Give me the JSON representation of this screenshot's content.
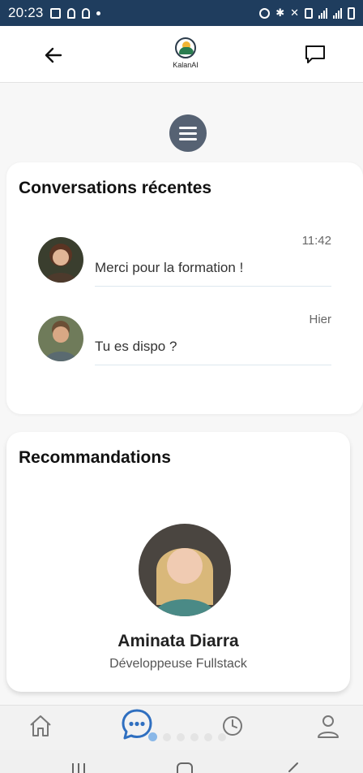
{
  "status_bar": {
    "time": "20:23"
  },
  "app": {
    "logo_text": "KalanAI"
  },
  "recent": {
    "title": "Conversations récentes",
    "items": [
      {
        "message": "Merci pour la formation !",
        "time": "11:42"
      },
      {
        "message": "Tu es dispo ?",
        "time": "Hier"
      }
    ]
  },
  "recommendations": {
    "title": "Recommandations",
    "name": "Aminata Diarra",
    "role": "Développeuse Fullstack"
  },
  "colors": {
    "primary": "#2f6fc0",
    "status_bar": "#1f3d5e",
    "menu_fab": "#566273"
  },
  "icons": {
    "back": "arrow-left-icon",
    "chat": "chat-bubble-icon",
    "menu": "hamburger-icon",
    "home": "home-icon",
    "messages": "chat-dots-icon",
    "history": "clock-icon",
    "profile": "user-icon"
  }
}
